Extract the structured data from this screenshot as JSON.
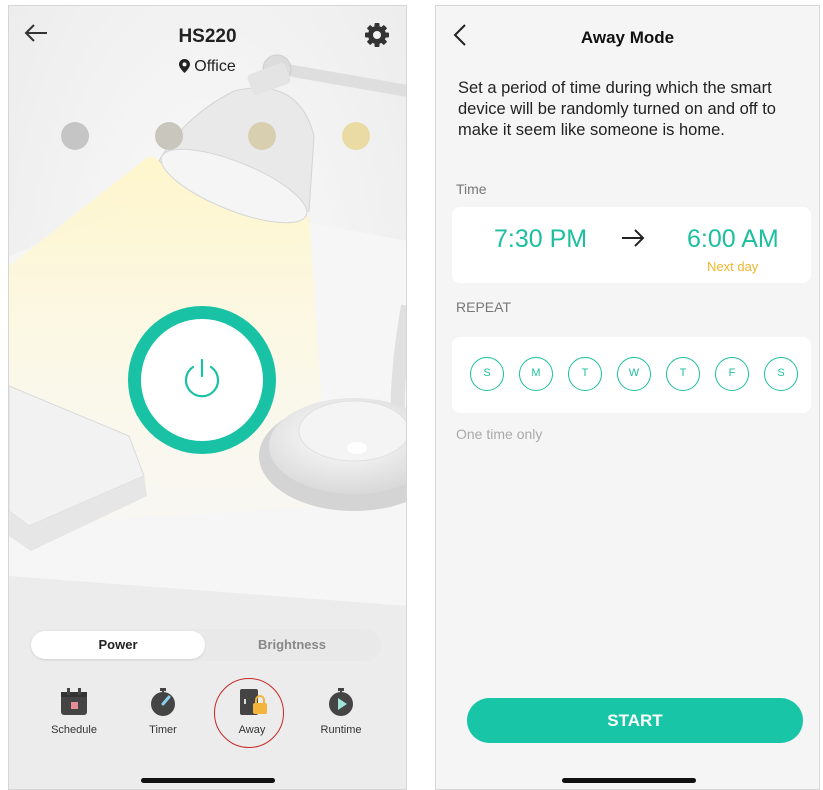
{
  "left_screen": {
    "back_icon": "arrow-left-icon",
    "title": "HS220",
    "location": "Office",
    "location_icon": "map-pin-icon",
    "settings_icon": "gear-icon",
    "brightness_presets": [
      "#c5c5c5",
      "#c9c6bd",
      "#d8ceb0",
      "#e9dba3"
    ],
    "accent_color": "#19c2a5",
    "tabs": [
      {
        "label": "Power",
        "selected": true
      },
      {
        "label": "Brightness",
        "selected": false
      }
    ],
    "tools": [
      {
        "label": "Schedule",
        "icon": "calendar-icon"
      },
      {
        "label": "Timer",
        "icon": "stopwatch-icon"
      },
      {
        "label": "Away",
        "icon": "away-lock-icon",
        "highlighted": true
      },
      {
        "label": "Runtime",
        "icon": "play-clock-icon"
      }
    ]
  },
  "right_screen": {
    "title": "Away Mode",
    "description": "Set a period of time during which the smart device will be randomly turned on and off to make it seem like someone is home.",
    "time_label": "Time",
    "start_time": "7:30 PM",
    "end_time": "6:00 AM",
    "end_note": "Next day",
    "repeat_label": "REPEAT",
    "days": [
      "S",
      "M",
      "T",
      "W",
      "T",
      "F",
      "S"
    ],
    "repeat_summary": "One time only",
    "start_button": "START",
    "accent_color": "#1dbf9f",
    "note_color": "#f0b62c"
  }
}
